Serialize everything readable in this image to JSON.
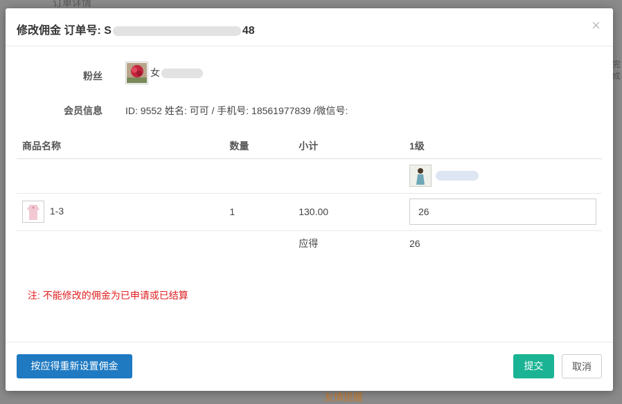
{
  "backdrop": {
    "top_text": "订单详情",
    "bottom_text": "友情提醒",
    "right_text": "完成"
  },
  "modal": {
    "title_prefix": "修改佣金 订单号: S",
    "title_suffix": "48",
    "close_glyph": "×"
  },
  "fans": {
    "label": "粉丝",
    "name_initial": "女"
  },
  "member": {
    "label": "会员信息",
    "info": "ID: 9552 姓名: 可可 / 手机号: 18561977839 /微信号:"
  },
  "table": {
    "headers": [
      "商品名称",
      "数量",
      "小计",
      "1级"
    ],
    "product": {
      "name": "1-3",
      "quantity": "1",
      "subtotal": "130.00",
      "level1_value": "26"
    },
    "summary": {
      "label": "应得",
      "value": "26"
    }
  },
  "note": "注: 不能修改的佣金为已申请或已结算",
  "footer": {
    "reset_label": "按应得重新设置佣金",
    "submit_label": "提交",
    "cancel_label": "取消"
  },
  "colors": {
    "primary": "#1f7ac2",
    "success": "#1ab394",
    "warning_text": "#e02020"
  },
  "icons": {
    "close": "close-icon",
    "fan_avatar": "flower-avatar-icon",
    "level1_avatar": "person-avatar-icon",
    "product_thumb": "clothing-thumb-icon"
  }
}
